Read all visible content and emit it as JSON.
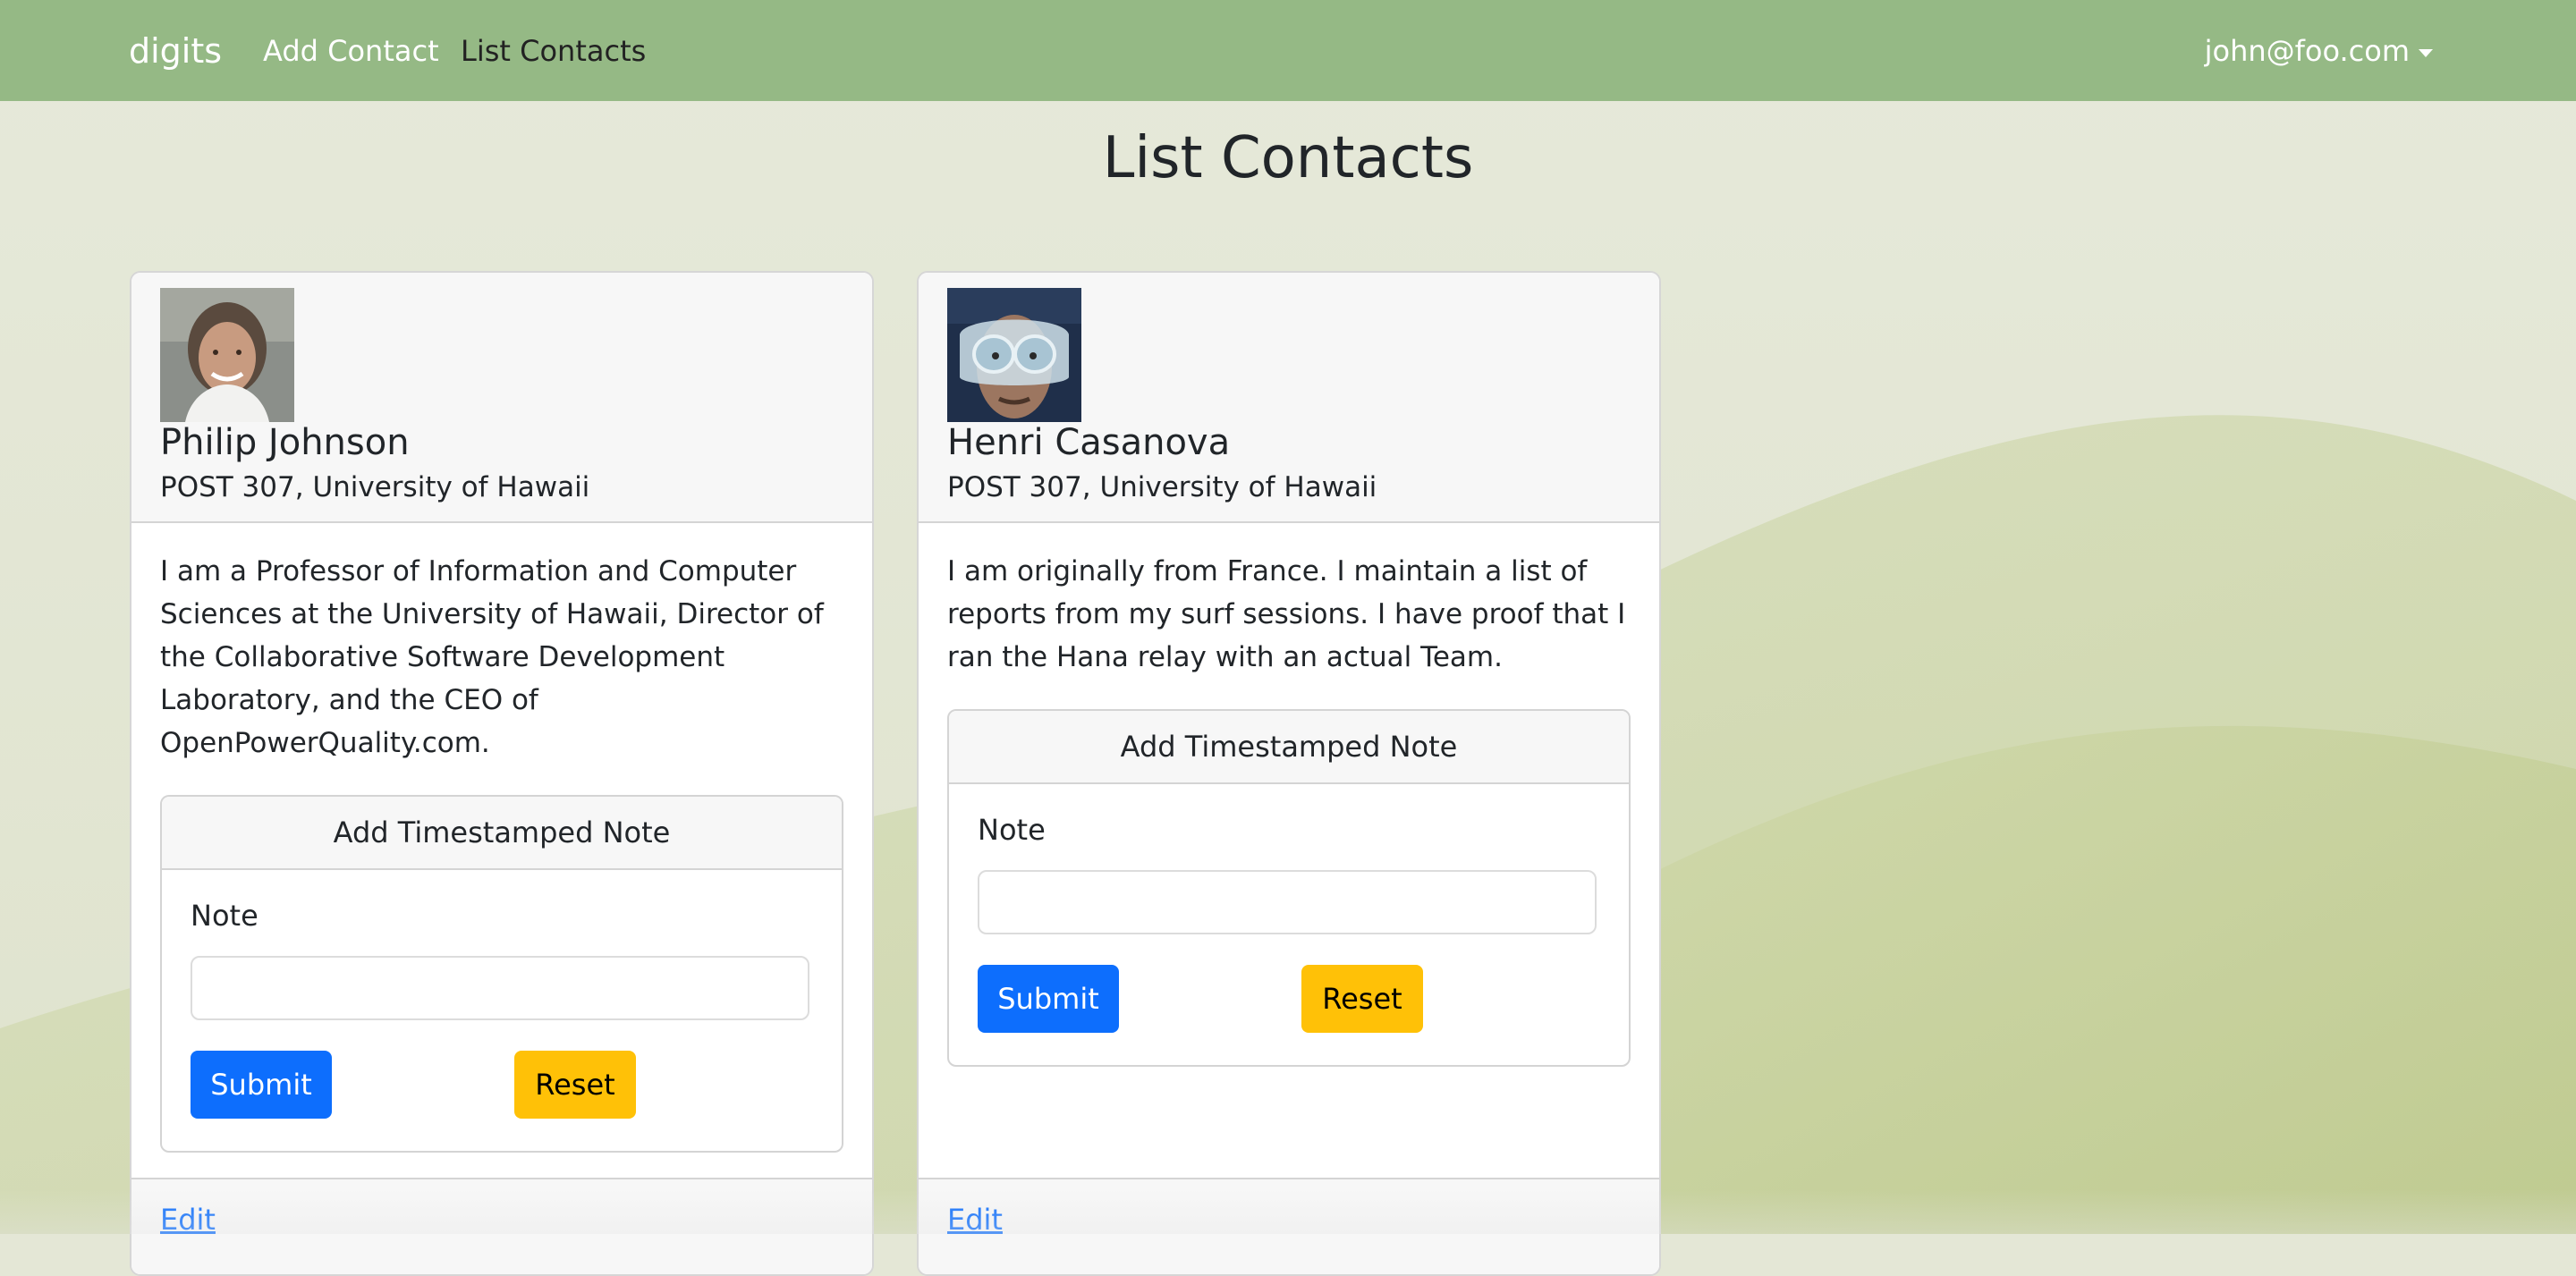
{
  "navbar": {
    "brand": "digits",
    "links": [
      "Add Contact",
      "List Contacts"
    ],
    "active_link": "List Contacts",
    "user": "john@foo.com"
  },
  "page": {
    "title": "List Contacts"
  },
  "contacts": [
    {
      "name": "Philip Johnson",
      "address": "POST 307, University of Hawaii",
      "description_lines": [
        "I am a Professor of Information and Computer",
        "Sciences at the University of Hawaii, Director of",
        "the Collaborative Software Development",
        "Laboratory, and the CEO of",
        "OpenPowerQuality.com."
      ],
      "note_form": {
        "header": "Add Timestamped Note",
        "label": "Note",
        "value": "",
        "submit_label": "Submit",
        "reset_label": "Reset"
      },
      "edit_label": "Edit"
    },
    {
      "name": "Henri Casanova",
      "address": "POST 307, University of Hawaii",
      "description_lines": [
        "I am originally from France. I maintain a list of",
        "reports from my surf sessions. I have proof that I",
        "ran the Hana relay with an actual Team."
      ],
      "note_form": {
        "header": "Add Timestamped Note",
        "label": "Note",
        "value": "",
        "submit_label": "Submit",
        "reset_label": "Reset"
      },
      "edit_label": "Edit"
    }
  ],
  "colors": {
    "navbar": "#95b985",
    "background": "#e4e7d6",
    "hills": "#c2cd97",
    "submit": "#0d6efd",
    "reset": "#ffc107",
    "link": "#0d6efd"
  }
}
